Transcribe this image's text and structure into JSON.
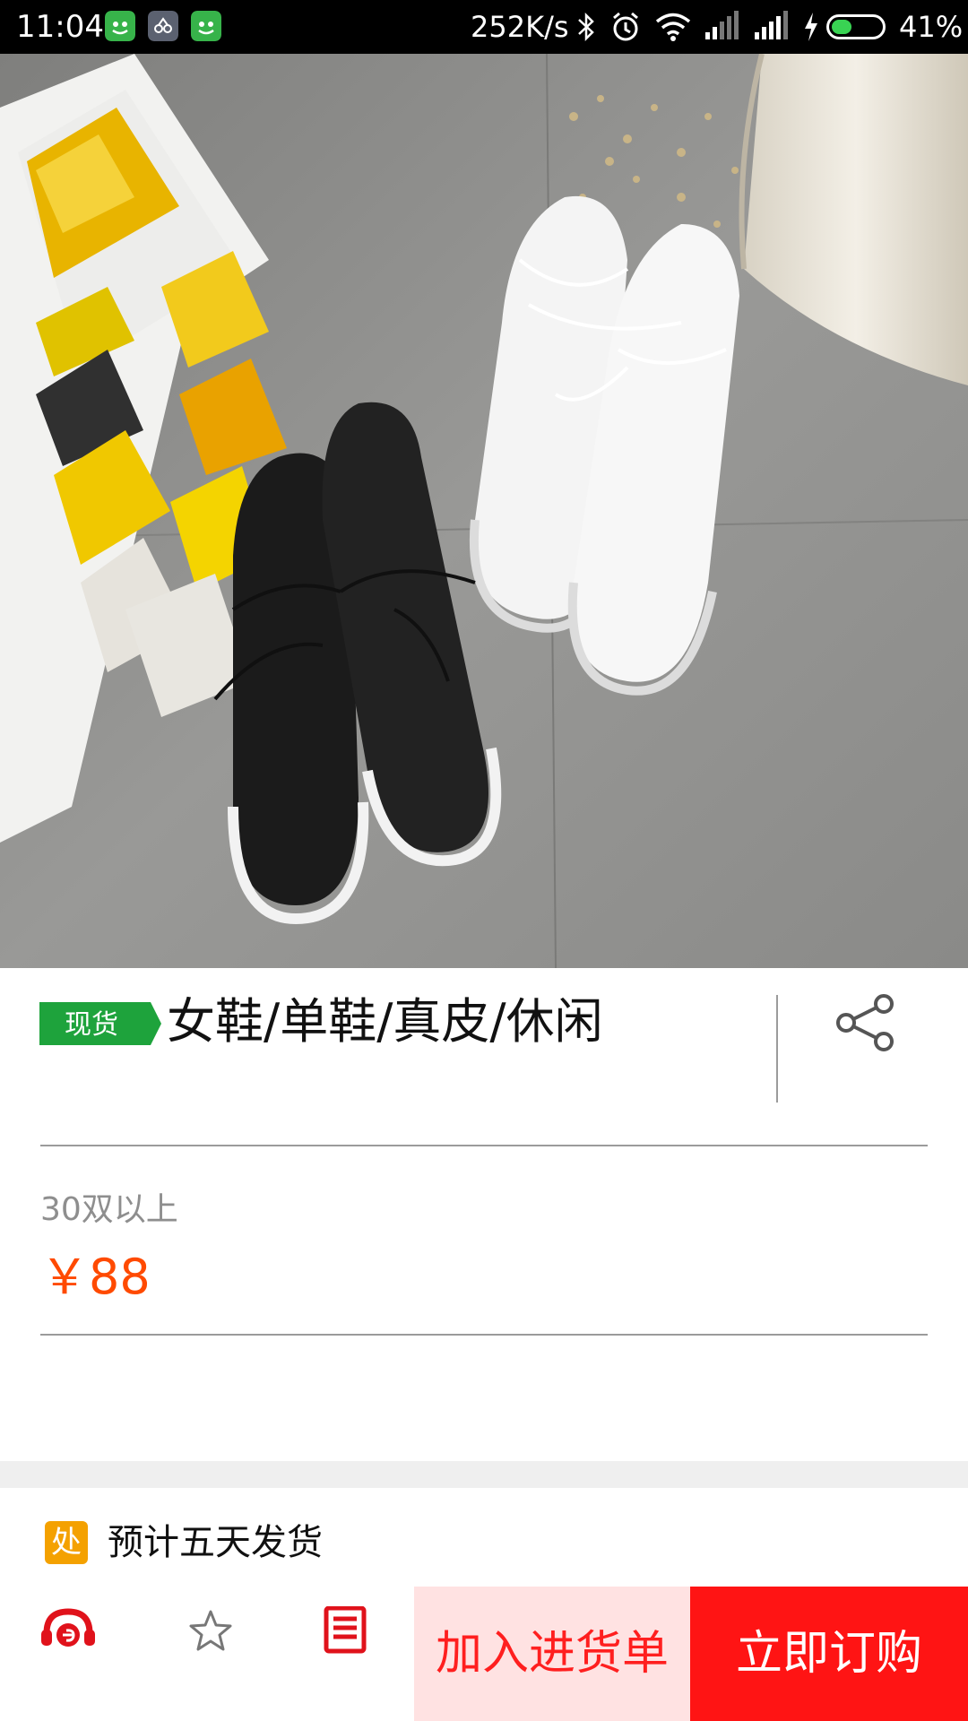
{
  "status_bar": {
    "time": "11:04",
    "network_speed": "252K/s",
    "battery_percent": "41%",
    "battery_level": 0.41,
    "icons": [
      "wechat-icon",
      "app-icon",
      "wechat-icon",
      "bluetooth-icon",
      "alarm-icon",
      "wifi-icon",
      "signal-icon",
      "signal-icon",
      "charging-icon",
      "battery-icon"
    ]
  },
  "product": {
    "image_name": "product-photo",
    "tag": "现货",
    "title": "女鞋/单鞋/真皮/休闲",
    "share_icon": "share-icon"
  },
  "pricing": {
    "quantity_label": "30双以上",
    "price": "￥88"
  },
  "shipping": {
    "icon_char": "处",
    "text": "预计五天发货"
  },
  "bottom_bar": {
    "icons": [
      "customer-service-icon",
      "star-icon",
      "list-icon"
    ],
    "add_to_cart_label": "加入进货单",
    "buy_now_label": "立即订购"
  },
  "colors": {
    "accent_orange": "#ff4a00",
    "buy_red": "#ff1414",
    "cart_bg": "#ffe2e2",
    "tag_green": "#1ea33c",
    "ship_orange": "#f4a100"
  }
}
